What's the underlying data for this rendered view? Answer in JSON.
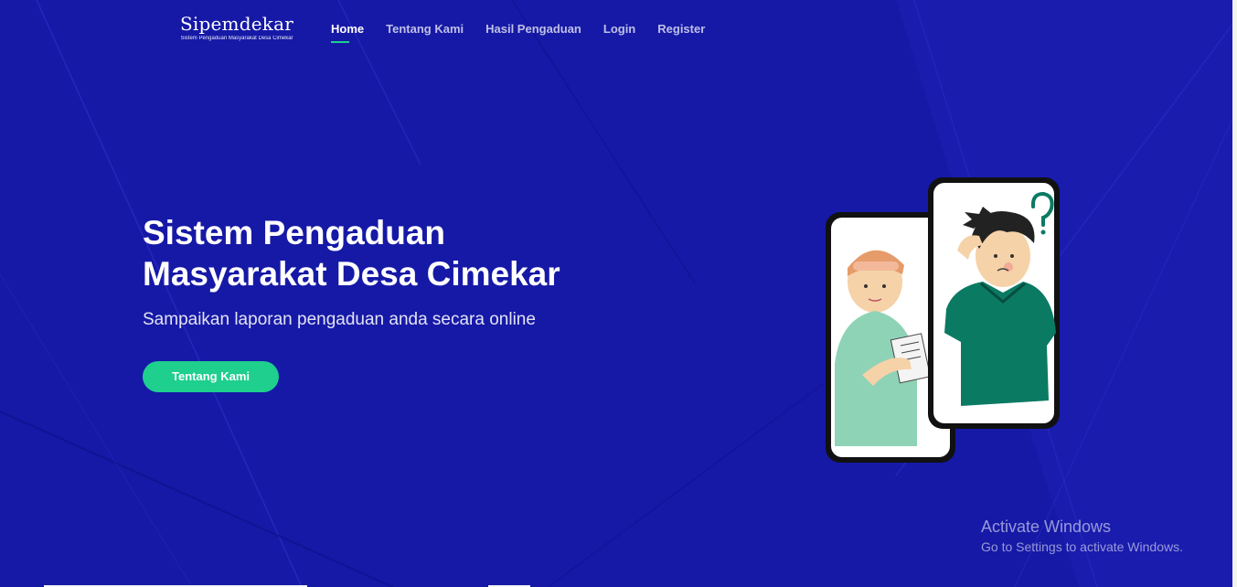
{
  "brand": {
    "name": "Sipemdekar",
    "tagline": "Sistem Pengaduan Masyarakat Desa Cimekar"
  },
  "nav": {
    "items": [
      {
        "label": "Home",
        "active": true
      },
      {
        "label": "Tentang Kami",
        "active": false
      },
      {
        "label": "Hasil Pengaduan",
        "active": false
      },
      {
        "label": "Login",
        "active": false
      },
      {
        "label": "Register",
        "active": false
      }
    ]
  },
  "hero": {
    "title_line1": "Sistem Pengaduan",
    "title_line2": "Masyarakat Desa Cimekar",
    "subtitle": "Sampaikan laporan pengaduan anda secara online",
    "cta_label": "Tentang Kami",
    "illustration_icon": "two-phones-people-illustration"
  },
  "os_watermark": {
    "title": "Activate Windows",
    "subtitle": "Go to Settings to activate Windows."
  },
  "colors": {
    "background": "#1619a6",
    "accent": "#1ecf8e",
    "text": "#ffffff"
  }
}
